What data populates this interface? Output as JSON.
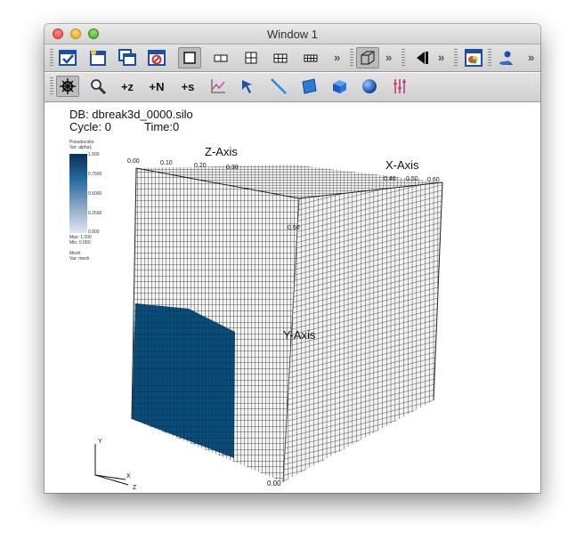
{
  "window": {
    "title": "Window 1"
  },
  "toolbar1": {
    "buttons": [
      "active-window-checkbox",
      "new-window",
      "clone-window",
      "delete-window",
      "layout-1x1",
      "layout-1x2",
      "layout-2x2",
      "layout-2x3",
      "layout-3x3",
      "view-3d",
      "animation-back",
      "popup-palette",
      "lock-view"
    ],
    "chevron": "»"
  },
  "toolbar2": {
    "buttons": [
      "navigate",
      "zoom",
      "pick-zone",
      "pick-node",
      "pick-surface",
      "lineout",
      "pick-tool",
      "line-tool",
      "plane-tool",
      "box-tool",
      "sphere-tool",
      "axis-restriction"
    ],
    "labels": {
      "pick_zone": "+z",
      "pick_node": "+N",
      "pick_surface": "+s"
    }
  },
  "viewport": {
    "db_line": "DB: dbreak3d_0000.silo",
    "cycle_line": "Cycle: 0",
    "time_line": "Time:0",
    "legend": {
      "pseudocolor_label": "Pseudocolor",
      "var_label": "Var: alpha1",
      "ticks": [
        "1.000",
        "0.7500",
        "0.5000",
        "0.2500",
        "0.000"
      ],
      "max": "Max:  1.000",
      "min": "Min:  0.000",
      "mesh_label": "Mesh",
      "mesh_var": "Var: mesh"
    },
    "axes": {
      "z_axis": "Z-Axis",
      "x_axis": "X-Axis",
      "y_axis": "Y-Axis",
      "z_ticks": [
        "0.00",
        "0.10",
        "0.20",
        "0.30"
      ],
      "x_ticks": [
        "0.40",
        "0.50",
        "0.60"
      ],
      "y_ticks": [
        "0.50"
      ],
      "bottom_value": "0.00"
    },
    "triad": {
      "y": "Y",
      "x": "X",
      "z": "Z"
    }
  },
  "colors": {
    "fluid": "#0b4d7a",
    "mesh_bg": "#f4f4f4"
  }
}
